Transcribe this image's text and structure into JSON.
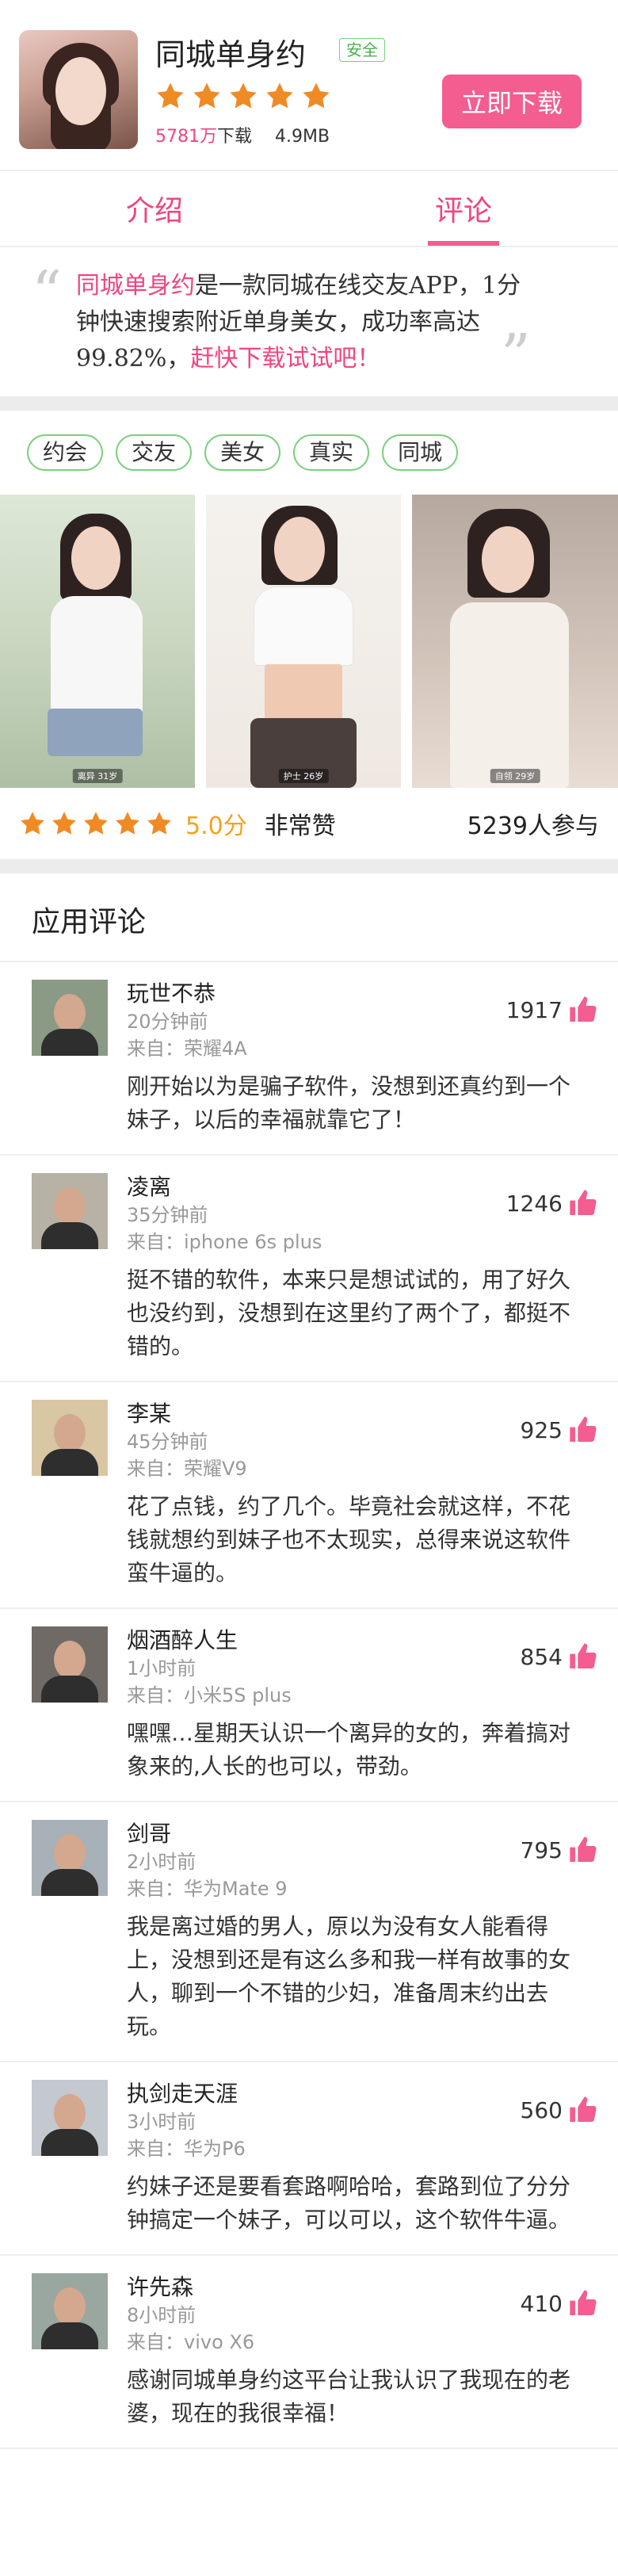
{
  "app": {
    "title": "同城单身约",
    "safe_badge": "安全",
    "rating_stars": 5,
    "download_count": "5781万",
    "download_suffix": "下载",
    "size": "4.9MB",
    "download_button": "立即下载"
  },
  "tabs": [
    {
      "label": "介绍",
      "active": false
    },
    {
      "label": "评论",
      "active": true
    }
  ],
  "intro": {
    "app_name": "同城单身约",
    "text": "是一款同城在线交友APP，1分钟快速搜索附近单身美女，成功率高达99.82%，",
    "cta": "赶快下载试试吧！"
  },
  "tags": [
    "约会",
    "交友",
    "美女",
    "真实",
    "同城"
  ],
  "photos": [
    {
      "caption": "离异 31岁"
    },
    {
      "caption": "护士 26岁"
    },
    {
      "caption": "自领 29岁"
    }
  ],
  "rating": {
    "score": "5.0分",
    "verdict": "非常赞",
    "participants": "5239人参与"
  },
  "comments_section": {
    "title": "应用评论"
  },
  "comments": [
    {
      "name": "玩世不恭",
      "time": "20分钟前",
      "device": "来自：荣耀4A",
      "likes": "1917",
      "text": "刚开始以为是骗子软件，没想到还真约到一个妹子，以后的幸福就靠它了！",
      "avatar_bg": "#8a9a84"
    },
    {
      "name": "凌离",
      "time": "35分钟前",
      "device": "来自：iphone 6s  plus",
      "likes": "1246",
      "text": "挺不错的软件，本来只是想试试的，用了好久也没约到，没想到在这里约了两个了，都挺不错的。",
      "avatar_bg": "#b7b1a6"
    },
    {
      "name": "李某",
      "time": "45分钟前",
      "device": "来自：荣耀V9",
      "likes": "925",
      "text": "花了点钱，约了几个。毕竟社会就这样，不花钱就想约到妹子也不太现实，总得来说这软件蛮牛逼的。",
      "avatar_bg": "#d9c7a3"
    },
    {
      "name": "烟酒醉人生",
      "time": "1小时前",
      "device": "来自：小米5S plus",
      "likes": "854",
      "text": "嘿嘿…星期天认识一个离异的女的，奔着搞对象来的,人长的也可以，带劲。",
      "avatar_bg": "#6f6a66"
    },
    {
      "name": "剑哥",
      "time": "2小时前",
      "device": "来自：华为Mate 9",
      "likes": "795",
      "text": "我是离过婚的男人，原以为没有女人能看得上，没想到还是有这么多和我一样有故事的女人，聊到一个不错的少妇，准备周末约出去玩。",
      "avatar_bg": "#a8b0b8"
    },
    {
      "name": "执剑走天涯",
      "time": "3小时前",
      "device": "来自：华为P6",
      "likes": "560",
      "text": "约妹子还是要看套路啊哈哈，套路到位了分分钟搞定一个妹子，可以可以，这个软件牛逼。",
      "avatar_bg": "#c3c9cf"
    },
    {
      "name": "许先森",
      "time": "8小时前",
      "device": "来自：vivo X6",
      "likes": "410",
      "text": "感谢同城单身约这平台让我认识了我现在的老婆，现在的我很幸福！",
      "avatar_bg": "#9aa7a0"
    }
  ],
  "colors": {
    "brand_pink": "#f35d8f",
    "star_orange": "#f08a24",
    "tag_green": "#7ccf7f"
  }
}
